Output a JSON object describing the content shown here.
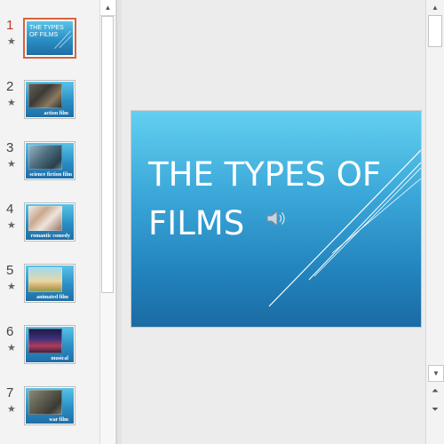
{
  "slides": [
    {
      "number": "1",
      "caption": "",
      "title": "THE TYPES OF FILMS",
      "active": true
    },
    {
      "number": "2",
      "caption": "action film"
    },
    {
      "number": "3",
      "caption": "science fiction film"
    },
    {
      "number": "4",
      "caption": "romantic comedy"
    },
    {
      "number": "5",
      "caption": "animated film"
    },
    {
      "number": "6",
      "caption": "musical"
    },
    {
      "number": "7",
      "caption": "war film"
    }
  ],
  "slide_icon": "star-icon",
  "main_slide": {
    "title_line1": "THE TYPES OF",
    "title_line2": "FILMS",
    "audio_icon": "speaker-icon"
  },
  "colors": {
    "accent_selected": "#d9603b",
    "slide_gradient_top": "#62d0f0",
    "slide_gradient_bottom": "#1b6ba3"
  },
  "scrollbar": {
    "up_glyph": "▲",
    "down_glyph": "▼",
    "prev_slide_glyph": "⏶",
    "next_slide_glyph": "⏷"
  }
}
